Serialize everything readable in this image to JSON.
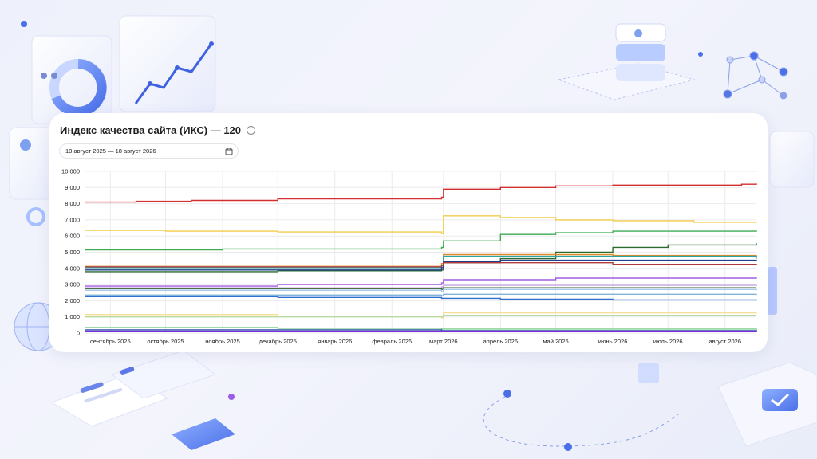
{
  "card": {
    "title": "Индекс качества сайта (ИКС) — 120",
    "info_icon": "info-icon",
    "date_range": "18 август 2025 — 18 август 2026",
    "calendar_icon": "calendar-icon"
  },
  "chart_data": {
    "type": "line",
    "title": "Индекс качества сайта (ИКС) — 120",
    "xlabel": "",
    "ylabel": "",
    "ylim": [
      0,
      10000
    ],
    "yticks": [
      0,
      1000,
      2000,
      3000,
      4000,
      5000,
      6000,
      7000,
      8000,
      9000,
      10000
    ],
    "ytick_labels": [
      "0",
      "1 000",
      "2 000",
      "3 000",
      "4 000",
      "5 000",
      "6 000",
      "7 000",
      "8 000",
      "9 000",
      "10 000"
    ],
    "xlim": [
      "2025-08-18",
      "2026-08-18"
    ],
    "xtick_labels": [
      "сентябрь 2025",
      "октябрь 2025",
      "ноябрь 2025",
      "декабрь 2025",
      "январь 2026",
      "февраль 2026",
      "март 2026",
      "апрель 2026",
      "май 2026",
      "июнь 2026",
      "июль 2026",
      "август 2026"
    ],
    "xtick_dates": [
      "2025-09-01",
      "2025-10-01",
      "2025-11-01",
      "2025-12-01",
      "2026-01-01",
      "2026-02-01",
      "2026-03-01",
      "2026-04-01",
      "2026-05-01",
      "2026-06-01",
      "2026-07-01",
      "2026-08-01"
    ],
    "grid": true,
    "legend": "none",
    "series": [
      {
        "color": "#d42f2f",
        "points": [
          [
            "2025-08-18",
            8100
          ],
          [
            "2025-09-15",
            8150
          ],
          [
            "2025-10-15",
            8200
          ],
          [
            "2025-12-01",
            8300
          ],
          [
            "2026-02-28",
            8400
          ],
          [
            "2026-03-01",
            8900
          ],
          [
            "2026-04-01",
            9000
          ],
          [
            "2026-05-01",
            9100
          ],
          [
            "2026-06-01",
            9150
          ],
          [
            "2026-08-10",
            9200
          ],
          [
            "2026-08-18",
            9250
          ]
        ]
      },
      {
        "color": "#f2cc4b",
        "points": [
          [
            "2025-08-18",
            6350
          ],
          [
            "2025-10-01",
            6300
          ],
          [
            "2025-12-01",
            6250
          ],
          [
            "2026-02-28",
            6150
          ],
          [
            "2026-03-01",
            7250
          ],
          [
            "2026-04-01",
            7150
          ],
          [
            "2026-05-01",
            7000
          ],
          [
            "2026-06-01",
            6950
          ],
          [
            "2026-07-15",
            6850
          ],
          [
            "2026-08-18",
            6800
          ]
        ]
      },
      {
        "color": "#3daa55",
        "points": [
          [
            "2025-08-18",
            5150
          ],
          [
            "2025-11-01",
            5200
          ],
          [
            "2026-02-28",
            5300
          ],
          [
            "2026-03-01",
            5700
          ],
          [
            "2026-04-01",
            6100
          ],
          [
            "2026-05-01",
            6200
          ],
          [
            "2026-06-01",
            6300
          ],
          [
            "2026-08-18",
            6400
          ]
        ]
      },
      {
        "color": "#2c6b2f",
        "points": [
          [
            "2025-08-18",
            3800
          ],
          [
            "2025-12-01",
            3850
          ],
          [
            "2026-02-28",
            3900
          ],
          [
            "2026-03-01",
            4350
          ],
          [
            "2026-04-01",
            4600
          ],
          [
            "2026-05-01",
            5000
          ],
          [
            "2026-06-01",
            5300
          ],
          [
            "2026-07-01",
            5450
          ],
          [
            "2026-08-18",
            5550
          ]
        ]
      },
      {
        "color": "#e08a2a",
        "points": [
          [
            "2025-08-18",
            4200
          ],
          [
            "2026-02-28",
            4300
          ],
          [
            "2026-03-01",
            4850
          ],
          [
            "2026-06-01",
            4800
          ],
          [
            "2026-08-18",
            4700
          ]
        ]
      },
      {
        "color": "#2aa6a0",
        "points": [
          [
            "2025-08-18",
            4050
          ],
          [
            "2026-02-28",
            4150
          ],
          [
            "2026-03-01",
            4750
          ],
          [
            "2026-08-18",
            4600
          ]
        ]
      },
      {
        "color": "#1f3f8f",
        "points": [
          [
            "2025-08-18",
            3900
          ],
          [
            "2026-02-28",
            4050
          ],
          [
            "2026-03-01",
            4400
          ],
          [
            "2026-04-01",
            4500
          ],
          [
            "2026-08-18",
            4450
          ]
        ]
      },
      {
        "color": "#b03a3a",
        "points": [
          [
            "2025-08-18",
            4100
          ],
          [
            "2026-02-28",
            4200
          ],
          [
            "2026-03-01",
            4350
          ],
          [
            "2026-06-01",
            4250
          ],
          [
            "2026-08-18",
            4200
          ]
        ]
      },
      {
        "color": "#a45de0",
        "points": [
          [
            "2025-08-18",
            2900
          ],
          [
            "2025-12-01",
            3000
          ],
          [
            "2026-02-28",
            3100
          ],
          [
            "2026-03-01",
            3300
          ],
          [
            "2026-05-01",
            3400
          ],
          [
            "2026-08-18",
            3450
          ]
        ]
      },
      {
        "color": "#c9a9e6",
        "points": [
          [
            "2025-08-18",
            2800
          ],
          [
            "2026-02-28",
            2850
          ],
          [
            "2026-03-01",
            2950
          ],
          [
            "2026-08-18",
            2900
          ]
        ]
      },
      {
        "color": "#355c2c",
        "points": [
          [
            "2025-08-18",
            2750
          ],
          [
            "2026-02-28",
            2700
          ],
          [
            "2026-03-01",
            2800
          ],
          [
            "2026-08-18",
            2800
          ]
        ]
      },
      {
        "color": "#9fc3e8",
        "points": [
          [
            "2025-08-18",
            2650
          ],
          [
            "2026-02-28",
            2550
          ],
          [
            "2026-03-01",
            2700
          ],
          [
            "2026-08-18",
            2650
          ]
        ]
      },
      {
        "color": "#7fb3d9",
        "points": [
          [
            "2025-08-18",
            2350
          ],
          [
            "2026-02-28",
            2300
          ],
          [
            "2026-03-01",
            2400
          ],
          [
            "2026-08-18",
            2350
          ]
        ]
      },
      {
        "color": "#2f6fd0",
        "points": [
          [
            "2025-08-18",
            2250
          ],
          [
            "2025-12-01",
            2200
          ],
          [
            "2026-02-28",
            2150
          ],
          [
            "2026-04-01",
            2100
          ],
          [
            "2026-06-01",
            2050
          ],
          [
            "2026-08-18",
            2000
          ]
        ]
      },
      {
        "color": "#f5de96",
        "points": [
          [
            "2025-08-18",
            1150
          ],
          [
            "2025-12-01",
            1050
          ],
          [
            "2026-02-28",
            950
          ],
          [
            "2026-03-01",
            1250
          ],
          [
            "2026-08-18",
            1200
          ]
        ]
      },
      {
        "color": "#b9d9a0",
        "points": [
          [
            "2025-08-18",
            1000
          ],
          [
            "2026-02-28",
            1000
          ],
          [
            "2026-03-01",
            1100
          ],
          [
            "2026-08-18",
            1100
          ]
        ]
      },
      {
        "color": "#7fcf8f",
        "points": [
          [
            "2025-08-18",
            350
          ],
          [
            "2025-12-01",
            300
          ],
          [
            "2026-02-28",
            250
          ],
          [
            "2026-08-18",
            150
          ]
        ]
      },
      {
        "color": "#2c4fa8",
        "points": [
          [
            "2025-08-18",
            200
          ],
          [
            "2026-02-28",
            150
          ],
          [
            "2026-08-18",
            100
          ]
        ]
      },
      {
        "color": "#7b2fd8",
        "points": [
          [
            "2025-08-18",
            120
          ],
          [
            "2026-08-18",
            100
          ]
        ]
      }
    ]
  }
}
